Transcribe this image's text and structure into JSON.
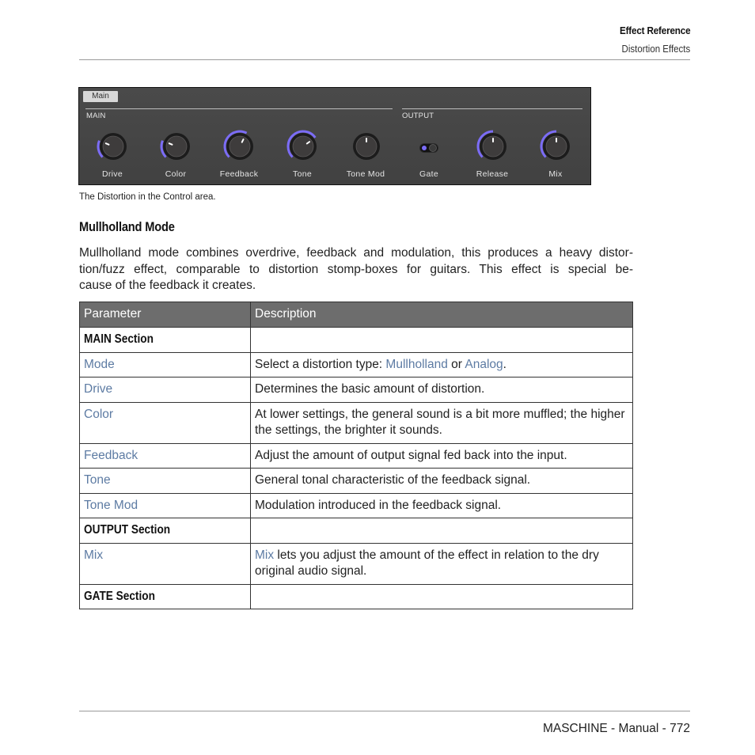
{
  "header": {
    "chapter": "Effect Reference",
    "section": "Distortion Effects"
  },
  "plugin_panel": {
    "tab": "Main",
    "accent_color": "#7b6cf6",
    "sections": [
      {
        "label": "MAIN"
      },
      {
        "label": "OUTPUT"
      }
    ],
    "controls": [
      {
        "label": "Drive",
        "type": "knob",
        "value": 0.25
      },
      {
        "label": "Color",
        "type": "knob",
        "value": 0.25
      },
      {
        "label": "Feedback",
        "type": "knob",
        "value": 0.6
      },
      {
        "label": "Tone",
        "type": "knob",
        "value": 0.7
      },
      {
        "label": "Tone Mod",
        "type": "knob",
        "value": 0.0,
        "pointer": 0.5
      },
      {
        "label": "Gate",
        "type": "toggle",
        "value": "on"
      },
      {
        "label": "Release",
        "type": "knob",
        "value": 0.5
      },
      {
        "label": "Mix",
        "type": "knob",
        "value": 0.5
      }
    ]
  },
  "caption": "The Distortion in the Control area.",
  "section_title": "Mullholland Mode",
  "intro_lines": [
    "Mullholland mode combines overdrive, feedback and modulation, this produces a heavy distor-",
    "tion/fuzz effect, comparable to distortion stomp-boxes for guitars. This effect is special be-",
    "cause of the feedback it creates."
  ],
  "table": {
    "headers": [
      "Parameter",
      "Description"
    ],
    "rows": [
      {
        "kind": "section",
        "param": "MAIN Section",
        "desc": ""
      },
      {
        "kind": "param",
        "param": "Mode",
        "desc_parts": [
          {
            "text": "Select a distortion type: ",
            "link": false
          },
          {
            "text": "Mullholland",
            "link": true
          },
          {
            "text": " or ",
            "link": false
          },
          {
            "text": "Analog",
            "link": true
          },
          {
            "text": ".",
            "link": false
          }
        ]
      },
      {
        "kind": "param",
        "param": "Drive",
        "desc_parts": [
          {
            "text": "Determines the basic amount of distortion.",
            "link": false
          }
        ]
      },
      {
        "kind": "param",
        "param": "Color",
        "desc_parts": [
          {
            "text": "At lower settings, the general sound is a bit more muffled; the higher the settings, the brighter it sounds.",
            "link": false
          }
        ]
      },
      {
        "kind": "param",
        "param": "Feedback",
        "desc_parts": [
          {
            "text": "Adjust the amount of output signal fed back into the input.",
            "link": false
          }
        ]
      },
      {
        "kind": "param",
        "param": "Tone",
        "desc_parts": [
          {
            "text": "General tonal characteristic of the feedback signal.",
            "link": false
          }
        ]
      },
      {
        "kind": "param",
        "param": "Tone Mod",
        "desc_parts": [
          {
            "text": "Modulation introduced in the feedback signal.",
            "link": false
          }
        ]
      },
      {
        "kind": "section",
        "param": "OUTPUT Section",
        "desc": ""
      },
      {
        "kind": "param",
        "param": "Mix",
        "desc_parts": [
          {
            "text": "Mix",
            "link": true
          },
          {
            "text": " lets you adjust the amount of the effect in relation to the dry original audio signal.",
            "link": false
          }
        ]
      },
      {
        "kind": "section",
        "param": "GATE Section",
        "desc": ""
      }
    ]
  },
  "footer": "MASCHINE - Manual - 772"
}
